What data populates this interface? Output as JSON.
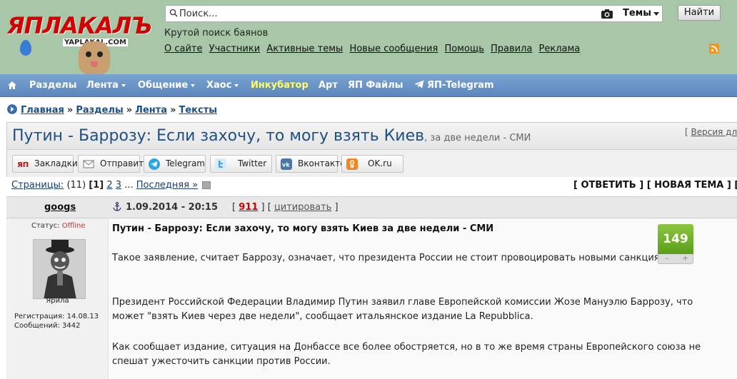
{
  "header": {
    "logo_text": "ЯПЛАКАЛЪ",
    "logo_subtext": "YAPLAKAL.COM",
    "search_placeholder": "Поиск...",
    "search_scope": "Темы",
    "search_button": "Найти",
    "tagline": "Крутой поиск баянов",
    "links": [
      "О сайте",
      "Участники",
      "Активные темы",
      "Новые сообщения",
      "Помощь",
      "Правила",
      "Реклама"
    ]
  },
  "nav": {
    "items": [
      {
        "label": "Разделы",
        "dropdown": false
      },
      {
        "label": "Лента",
        "dropdown": true
      },
      {
        "label": "Общение",
        "dropdown": true
      },
      {
        "label": "Хаос",
        "dropdown": true
      },
      {
        "label": "Инкубатор",
        "dropdown": false
      },
      {
        "label": "Арт",
        "dropdown": false
      },
      {
        "label": "ЯП Файлы",
        "dropdown": false
      },
      {
        "label": "ЯП-Telegram",
        "dropdown": false
      }
    ]
  },
  "breadcrumb": [
    "Главная",
    "Разделы",
    "Лента",
    "Тексты"
  ],
  "topic": {
    "title": "Путин - Баррозу: Если захочу, то могу взять Киев",
    "subtitle": ", за две недели - СМИ",
    "version_prefix": "[ ",
    "version_link": "Версия для"
  },
  "share": [
    "Закладки",
    "Отправить",
    "Telegram",
    "Twitter",
    "Вконтакте",
    "OK.ru"
  ],
  "pager": {
    "label": "Страницы:",
    "count": "(11)",
    "current": "[1]",
    "pages": [
      "2",
      "3"
    ],
    "ellipsis": "...",
    "last": "Последняя »"
  },
  "actions": "[ ОТВЕТИТЬ ] [ НОВАЯ ТЕМА ] [ О",
  "post": {
    "author": "googs",
    "status_label": "Статус:",
    "status_value": "Offline",
    "avatar_caption": "Ярила",
    "registration": "Регистрация: 14.08.13",
    "messages": "Сообщений: 3442",
    "date": "1.09.2014 - 20:15",
    "number": "911",
    "quote": "цитировать",
    "heading": "Путин - Баррозу: Если захочу, то могу взять Киев за две недели - СМИ",
    "paragraphs": [
      "Такое заявление, считает Баррозу, означает, что президента России не стоит провоцировать новыми санкциями.",
      "Президент Российской Федерации Владимир Путин заявил главе Европейской комиссии Жозе Мануэлю Баррозу, что может \"взять Киев через две недели\", сообщает итальянское издание La Repubblica.",
      "Как сообщает издание, ситуация на Донбассе все более обостряется, но в то же время страны Европейского союза не спешат ужесточить санкции против России."
    ],
    "rating": "149",
    "rating_minus": "–",
    "rating_plus": "+"
  },
  "colors": {
    "header_bg": "#a8c6a8",
    "nav_bg": "#6b96c8",
    "incubator": "#ffff66",
    "rating_green": "#73b22e",
    "post_number": "#cc0000"
  }
}
